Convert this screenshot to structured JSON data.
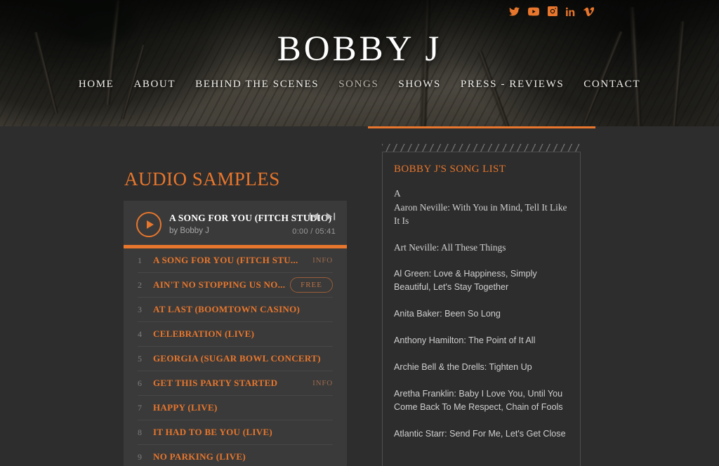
{
  "site": {
    "title": "BOBBY J",
    "accent_color": "#e8762c",
    "background_color": "#2d2d2d",
    "panel_color": "#3a3a3a"
  },
  "socials": [
    {
      "name": "twitter-icon",
      "label": "Twitter"
    },
    {
      "name": "youtube-icon",
      "label": "YouTube"
    },
    {
      "name": "instagram-icon",
      "label": "Instagram"
    },
    {
      "name": "linkedin-icon",
      "label": "LinkedIn"
    },
    {
      "name": "vimeo-icon",
      "label": "Vimeo"
    }
  ],
  "nav": [
    {
      "label": "HOME",
      "active": false
    },
    {
      "label": "ABOUT",
      "active": false
    },
    {
      "label": "BEHIND THE SCENES",
      "active": false
    },
    {
      "label": "SONGS",
      "active": true
    },
    {
      "label": "SHOWS",
      "active": false
    },
    {
      "label": "PRESS - REVIEWS",
      "active": false
    },
    {
      "label": "CONTACT",
      "active": false
    }
  ],
  "audio": {
    "section_title": "AUDIO SAMPLES",
    "now_playing": {
      "title": "A SONG FOR YOU (FITCH STUDIO)",
      "artist": "by Bobby J",
      "time": "0:00 / 05:41",
      "progress_percent": 100,
      "play_icon": "play-icon",
      "prev_icon": "skip-previous-icon",
      "next_icon": "skip-next-icon"
    },
    "tracks": [
      {
        "num": "1",
        "title": "A SONG FOR YOU (FITCH STU...",
        "info": "INFO",
        "free": ""
      },
      {
        "num": "2",
        "title": "AIN'T NO STOPPING US NO...",
        "info": "",
        "free": "FREE"
      },
      {
        "num": "3",
        "title": "AT LAST (BOOMTOWN CASINO)",
        "info": "",
        "free": ""
      },
      {
        "num": "4",
        "title": "CELEBRATION (LIVE)",
        "info": "",
        "free": ""
      },
      {
        "num": "5",
        "title": "GEORGIA (SUGAR BOWL CONCERT)",
        "info": "",
        "free": ""
      },
      {
        "num": "6",
        "title": "GET THIS PARTY STARTED",
        "info": "INFO",
        "free": ""
      },
      {
        "num": "7",
        "title": "HAPPY (LIVE)",
        "info": "",
        "free": ""
      },
      {
        "num": "8",
        "title": "IT HAD TO BE YOU (LIVE)",
        "info": "",
        "free": ""
      },
      {
        "num": "9",
        "title": "NO PARKING (LIVE)",
        "info": "",
        "free": ""
      }
    ]
  },
  "songlist": {
    "title": "BOBBY J'S SONG LIST",
    "entries": [
      {
        "text": "A",
        "style": "serif letter"
      },
      {
        "text": "Aaron Neville: With You in Mind, Tell It Like It Is",
        "style": "serif"
      },
      {
        "text": "Art Neville: All These Things",
        "style": "serif"
      },
      {
        "text": "Al Green: Love & Happiness, Simply Beautiful, Let's Stay Together",
        "style": ""
      },
      {
        "text": "Anita Baker: Been So Long",
        "style": ""
      },
      {
        "text": "Anthony Hamilton: The Point of It All",
        "style": ""
      },
      {
        "text": "Archie Bell & the Drells: Tighten Up",
        "style": ""
      },
      {
        "text": "Aretha Franklin: Baby I Love You, Until You Come Back To Me Respect, Chain of Fools",
        "style": ""
      },
      {
        "text": "Atlantic Starr: Send For Me, Let's Get Close",
        "style": ""
      }
    ]
  }
}
